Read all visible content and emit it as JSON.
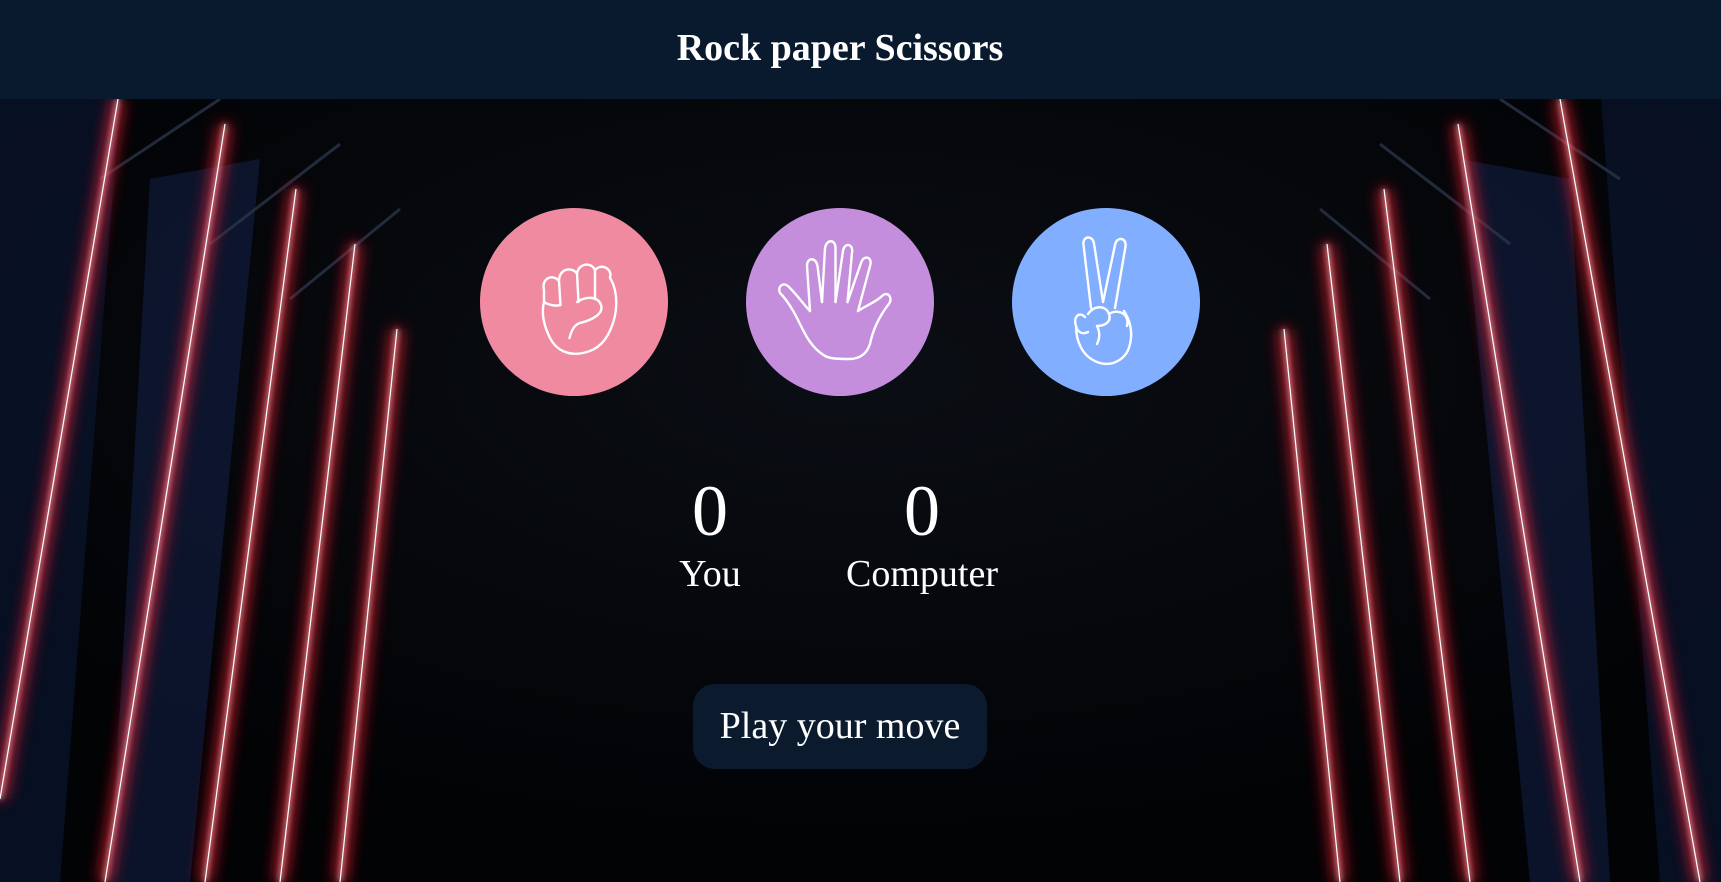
{
  "header": {
    "title": "Rock paper Scissors"
  },
  "choices": [
    {
      "id": "rock",
      "icon": "fist-icon",
      "color": "#f08aa0"
    },
    {
      "id": "paper",
      "icon": "open-hand-icon",
      "color": "#c48edd"
    },
    {
      "id": "scissors",
      "icon": "peace-sign-icon",
      "color": "#82aeff"
    }
  ],
  "scoreboard": {
    "user": {
      "score": "0",
      "label": "You"
    },
    "computer": {
      "score": "0",
      "label": "Computer"
    }
  },
  "message": {
    "text": "Play your move",
    "background": "#0b1a2d"
  },
  "colors": {
    "header_bg": "#0a1a2e",
    "neon": "#ff2a3a"
  }
}
